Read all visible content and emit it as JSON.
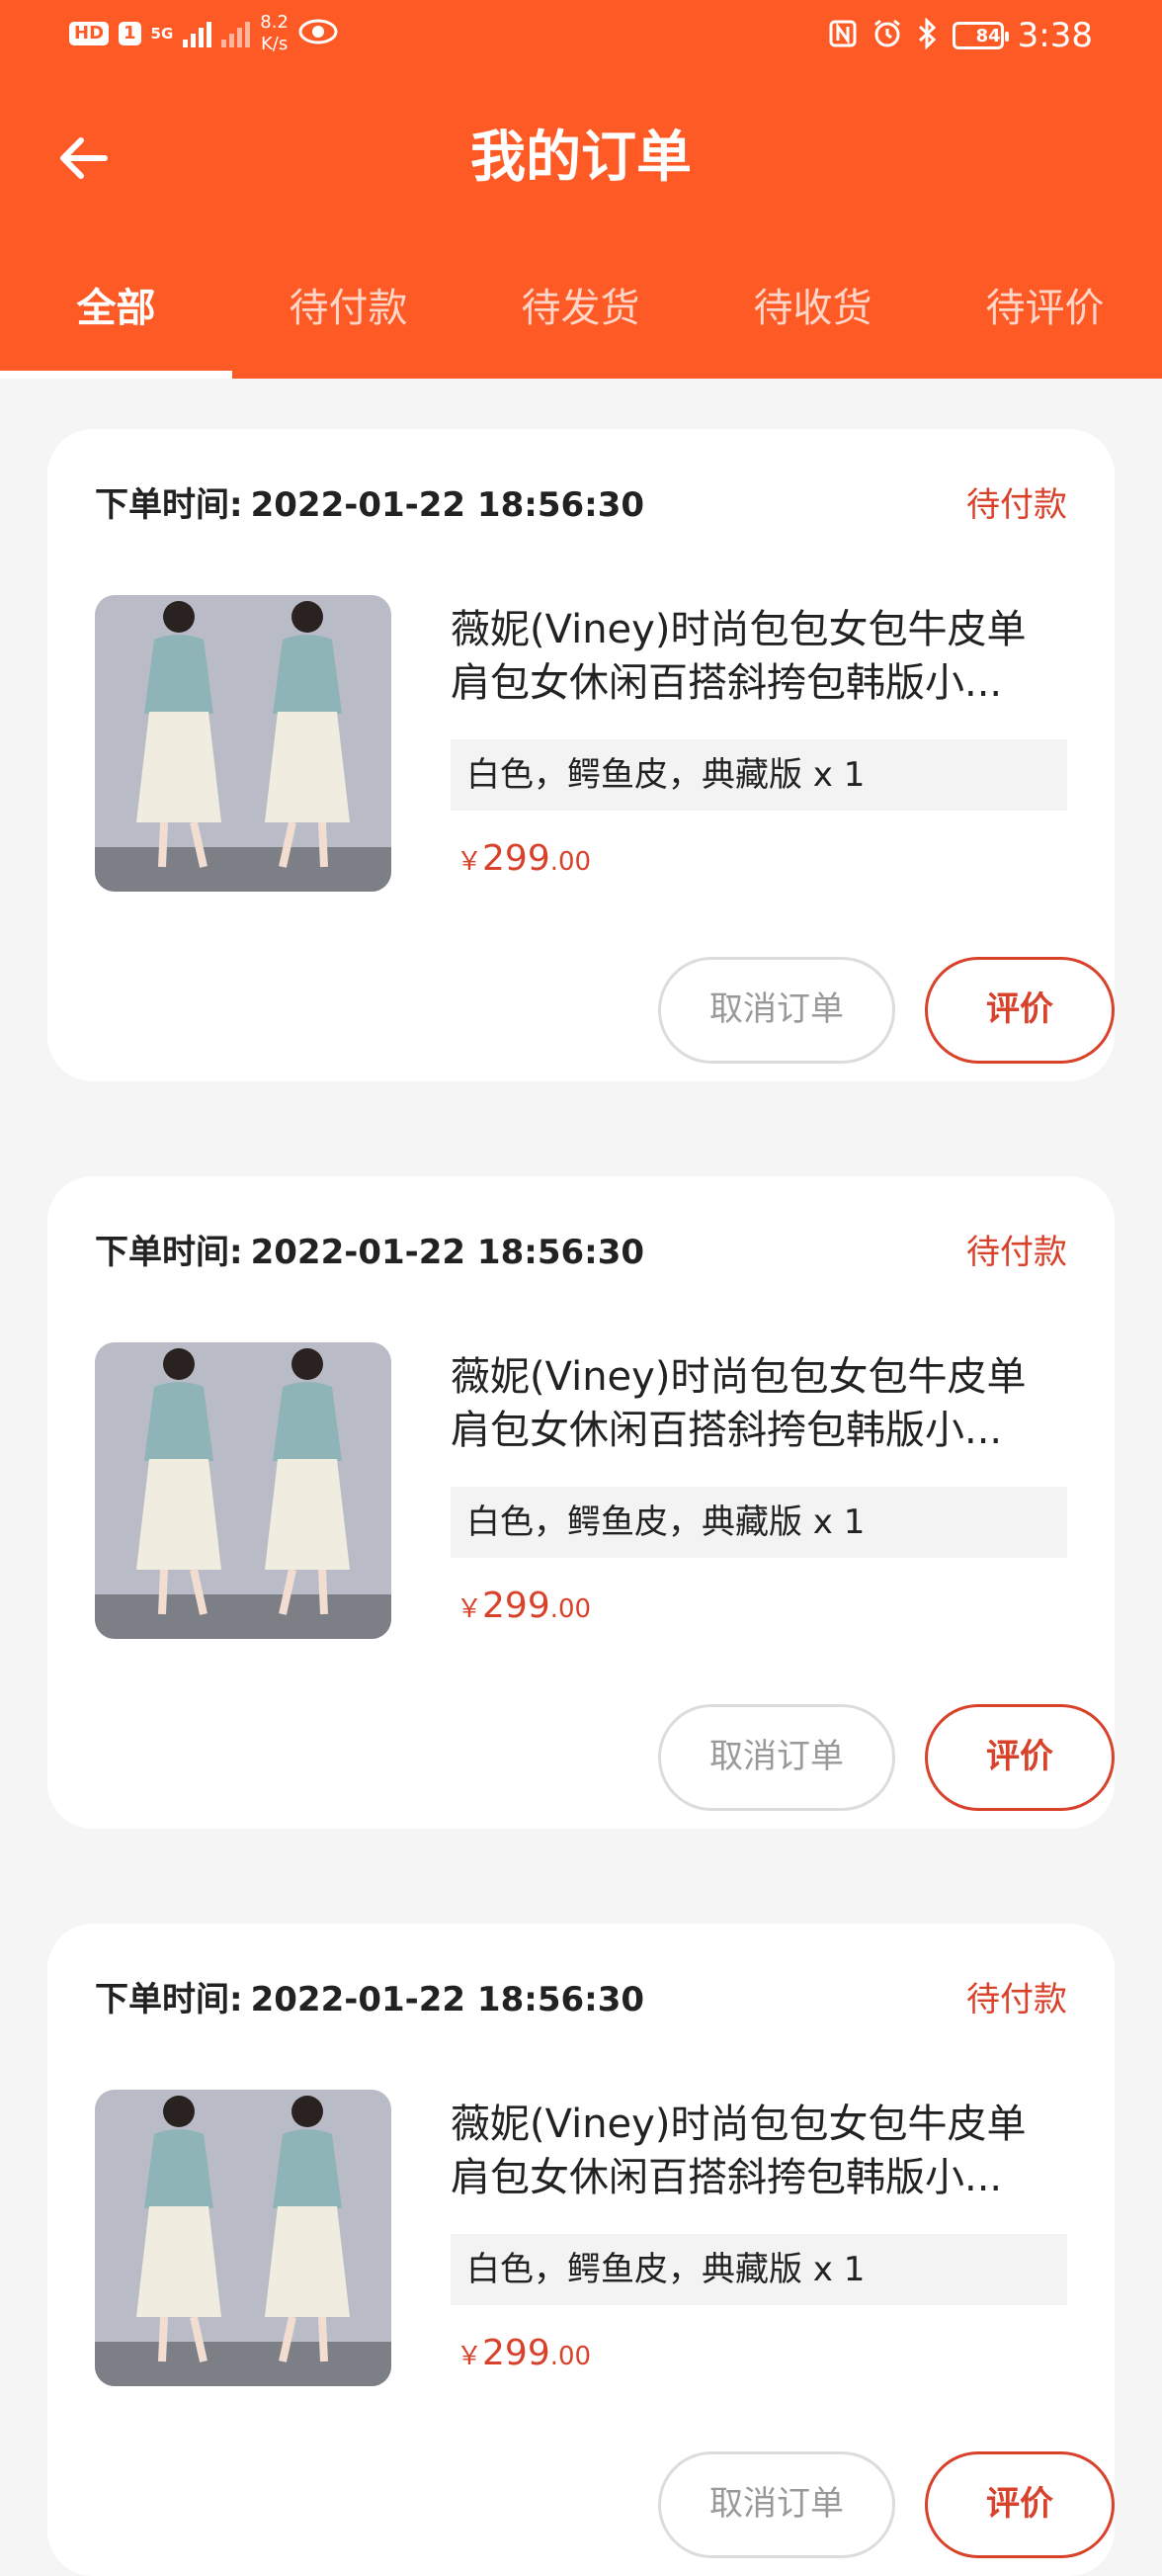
{
  "status_bar": {
    "left_badges": [
      "HD",
      "1"
    ],
    "signal_label": "5G",
    "speed_value": "8.2",
    "speed_unit": "K/s",
    "battery_level": "84",
    "time": "3:38"
  },
  "header": {
    "title": "我的订单"
  },
  "tabs": [
    {
      "label": "全部",
      "active": true
    },
    {
      "label": "待付款",
      "active": false
    },
    {
      "label": "待发货",
      "active": false
    },
    {
      "label": "待收货",
      "active": false
    },
    {
      "label": "待评价",
      "active": false
    }
  ],
  "orders": [
    {
      "time_label": "下单时间:",
      "time_value": "2022-01-22 18:56:30",
      "status": "待付款",
      "product_name": "薇妮(Viney)时尚包包女包牛皮单肩包女休闲百搭斜挎包韩版小...",
      "spec": "白色，鳄鱼皮，典藏版 x 1",
      "price_currency": "￥",
      "price_int": "299",
      "price_dec": ".00",
      "cancel_label": "取消订单",
      "review_label": "评价"
    },
    {
      "time_label": "下单时间:",
      "time_value": "2022-01-22 18:56:30",
      "status": "待付款",
      "product_name": "薇妮(Viney)时尚包包女包牛皮单肩包女休闲百搭斜挎包韩版小...",
      "spec": "白色，鳄鱼皮，典藏版 x 1",
      "price_currency": "￥",
      "price_int": "299",
      "price_dec": ".00",
      "cancel_label": "取消订单",
      "review_label": "评价"
    },
    {
      "time_label": "下单时间:",
      "time_value": "2022-01-22 18:56:30",
      "status": "待付款",
      "product_name": "薇妮(Viney)时尚包包女包牛皮单肩包女休闲百搭斜挎包韩版小...",
      "spec": "白色，鳄鱼皮，典藏版 x 1",
      "price_currency": "￥",
      "price_int": "299",
      "price_dec": ".00",
      "cancel_label": "取消订单",
      "review_label": "评价"
    }
  ],
  "colors": {
    "brand": "#fd5a26",
    "accent_red": "#d8412a",
    "background": "#f5f5f5"
  }
}
